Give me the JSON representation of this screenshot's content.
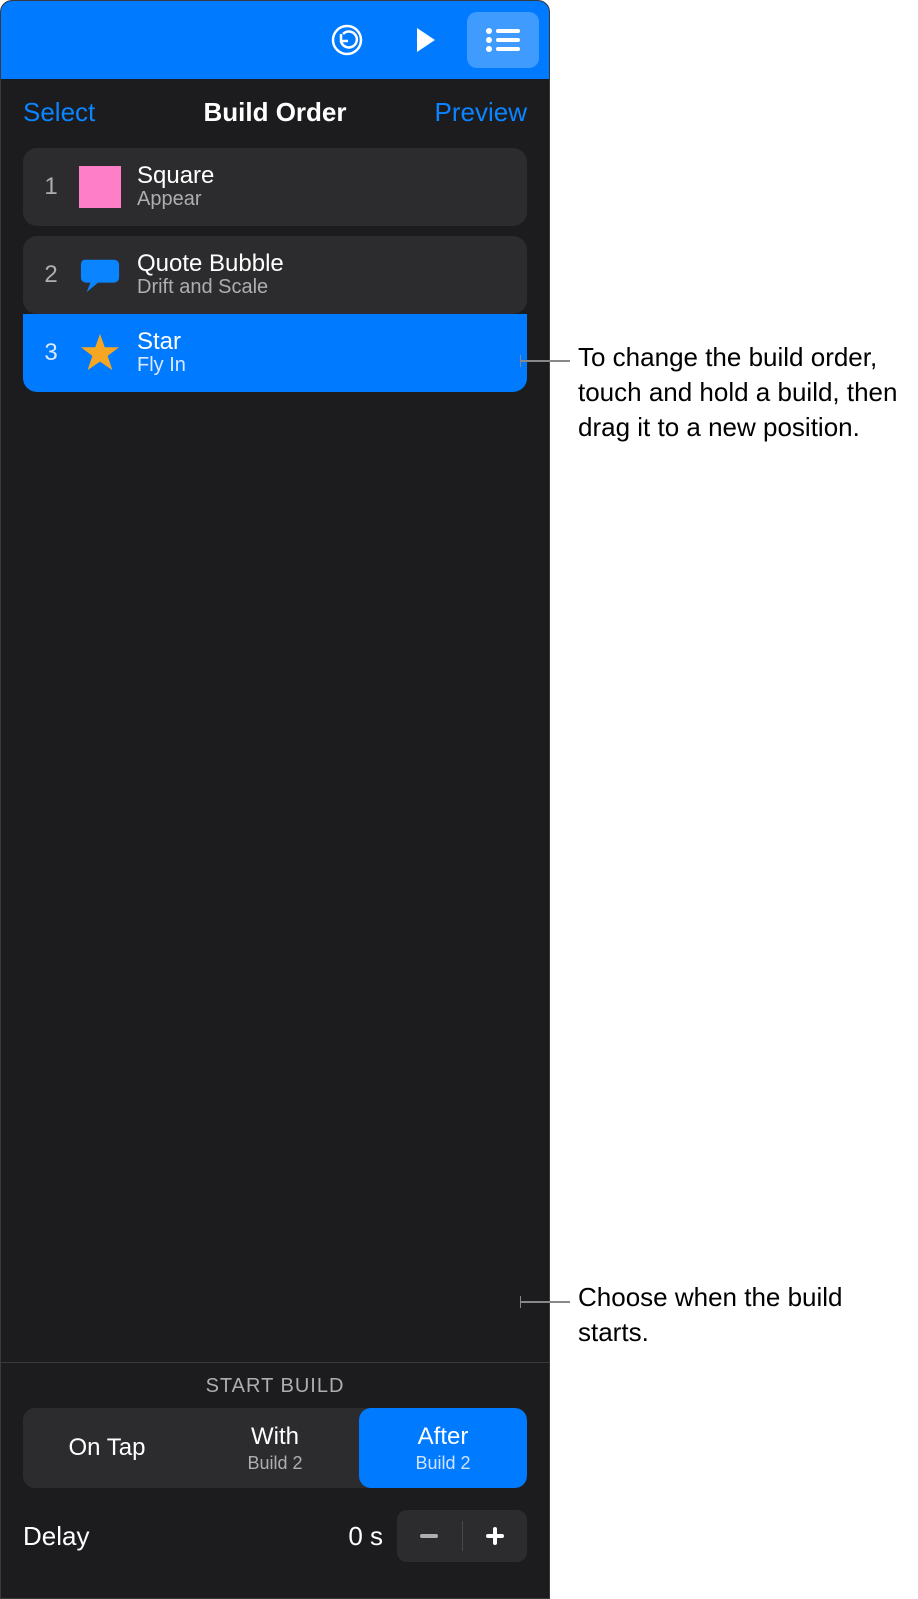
{
  "header": {
    "select_label": "Select",
    "title": "Build Order",
    "preview_label": "Preview"
  },
  "builds": [
    {
      "num": "1",
      "title": "Square",
      "effect": "Appear",
      "icon": "square",
      "selected": false
    },
    {
      "num": "2",
      "title": "Quote Bubble",
      "effect": "Drift and Scale",
      "icon": "bubble",
      "selected": false
    },
    {
      "num": "3",
      "title": "Star",
      "effect": "Fly In",
      "icon": "star",
      "selected": true
    }
  ],
  "footer": {
    "section_title": "START BUILD",
    "segments": [
      {
        "title": "On Tap",
        "subtitle": "",
        "active": false
      },
      {
        "title": "With",
        "subtitle": "Build 2",
        "active": false
      },
      {
        "title": "After",
        "subtitle": "Build 2",
        "active": true
      }
    ],
    "delay_label": "Delay",
    "delay_value": "0 s"
  },
  "callouts": {
    "reorder": "To change the build order, touch and hold a build, then drag it to a new position.",
    "start": "Choose when the build starts."
  },
  "colors": {
    "accent": "#007aff",
    "pink": "#ff7ec8",
    "gold": "#f5a623"
  }
}
